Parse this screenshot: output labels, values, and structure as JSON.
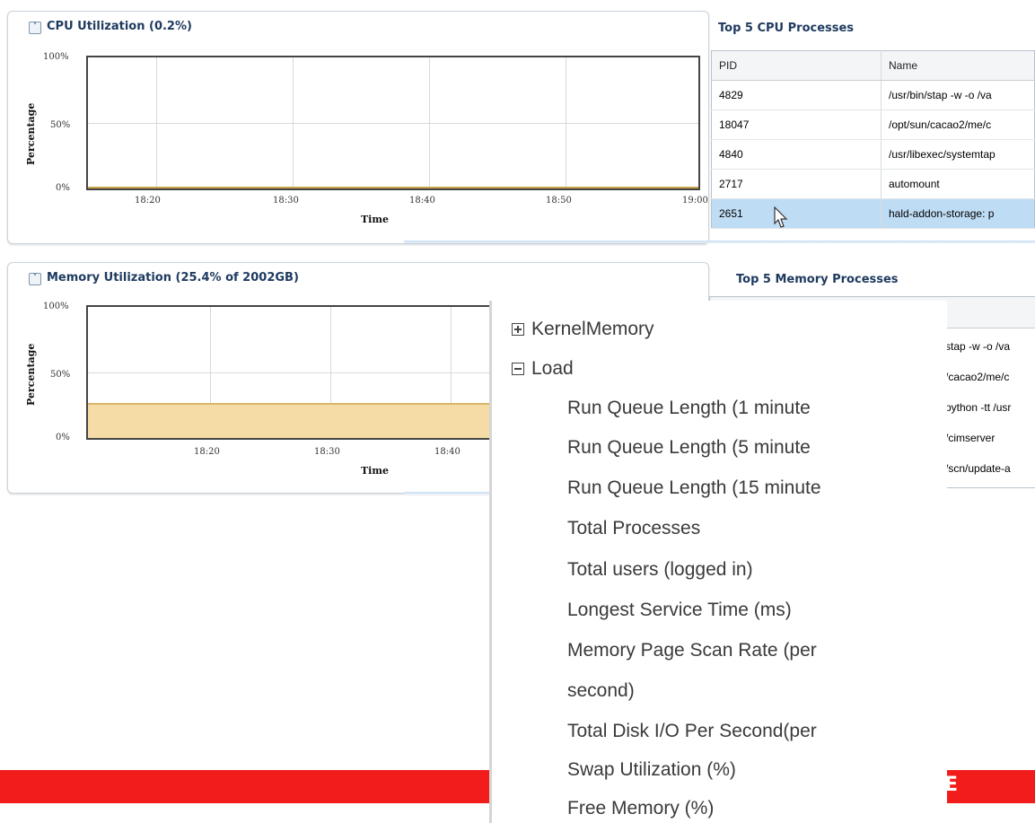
{
  "cpu_panel": {
    "title": "CPU Utilization (0.2%)",
    "chart_data": {
      "type": "area",
      "ylabel": "Percentage",
      "xlabel": "Time",
      "yticks": [
        "100%",
        "50%",
        "0%"
      ],
      "xticks": [
        "18:20",
        "18:30",
        "18:40",
        "18:50",
        "19:00"
      ],
      "ylim": [
        0,
        100
      ],
      "series": [
        {
          "values": [
            0.2,
            0.2,
            0.2,
            0.2,
            0.2
          ]
        }
      ],
      "fill_color": "#c8a24a"
    }
  },
  "top_cpu": {
    "title": "Top 5 CPU Processes",
    "columns": [
      "PID",
      "Name"
    ],
    "rows": [
      [
        "4829",
        "/usr/bin/stap -w -o /va"
      ],
      [
        "18047",
        "/opt/sun/cacao2/me/c"
      ],
      [
        "4840",
        "/usr/libexec/systemtap"
      ],
      [
        "2717",
        "automount"
      ],
      [
        "2651",
        "hald-addon-storage: p"
      ]
    ],
    "selected_row": 4
  },
  "memory_panel": {
    "title": "Memory Utilization (25.4% of 2002GB)",
    "chart_data": {
      "type": "area",
      "ylabel": "Percentage",
      "xlabel": "Time",
      "yticks": [
        "100%",
        "50%",
        "0%"
      ],
      "xticks": [
        "18:20",
        "18:30",
        "18:40"
      ],
      "ylim": [
        0,
        100
      ],
      "series": [
        {
          "values": [
            25.4,
            25.4,
            25.4
          ]
        }
      ],
      "fill_color": "#f5dca6"
    }
  },
  "top_memory": {
    "title": "Top 5 Memory Processes",
    "rows": [
      "stap -w -o /va",
      "/cacao2/me/c",
      "python -tt /usr",
      "/cimserver",
      "/scn/update-a"
    ]
  },
  "menu": {
    "items": [
      {
        "label": "KernelMemory",
        "type": "collapsed"
      },
      {
        "label": "Load",
        "type": "expanded"
      },
      {
        "label": "Run Queue Length (1 minute",
        "type": "child"
      },
      {
        "label": "Run Queue Length (5 minute",
        "type": "child"
      },
      {
        "label": "Run Queue Length (15 minute",
        "type": "child"
      },
      {
        "label": "Total Processes",
        "type": "child"
      },
      {
        "label": "Total users (logged in)",
        "type": "child"
      },
      {
        "label": "Longest Service Time (ms)",
        "type": "child"
      },
      {
        "label": "Memory Page Scan Rate (per",
        "type": "child"
      },
      {
        "label": "second)",
        "type": "child"
      },
      {
        "label": "Total Disk I/O Per Second(per",
        "type": "child"
      },
      {
        "label": "Swap Utilization (%)",
        "type": "child"
      },
      {
        "label": "Free Memory (%)",
        "type": "child"
      }
    ]
  },
  "footer": {
    "logo_fragment": "E",
    "bar_color": "#f21c1c"
  }
}
